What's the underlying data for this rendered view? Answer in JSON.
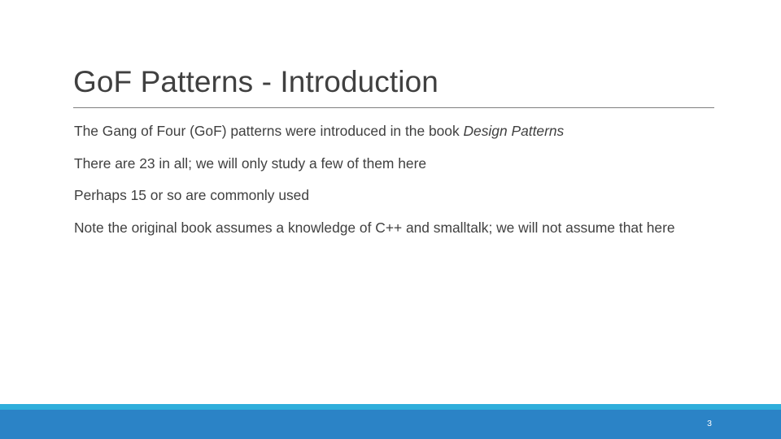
{
  "slide": {
    "title": "GoF Patterns - Introduction",
    "background_color": "#ffffff",
    "title_color": "#404040",
    "body_color": "#404040",
    "rule_color": "#7F7F7F",
    "body": [
      {
        "id": "line-1",
        "before_italic": "The Gang of Four (GoF) patterns were introduced in the book ",
        "italic": "Design Patterns",
        "after_italic": ""
      },
      {
        "id": "line-2",
        "text": "There are 23 in all; we will only study a few of them here"
      },
      {
        "id": "line-3",
        "text": "Perhaps 15 or so are commonly used"
      },
      {
        "id": "line-4",
        "text": "Note the original book assumes a knowledge of C++ and smalltalk; we will not assume that here"
      }
    ]
  },
  "footer": {
    "slide_number": "3",
    "accent_strip_color": "#2FAEDB",
    "bar_color": "#2B83C6",
    "number_color": "#ffffff"
  }
}
